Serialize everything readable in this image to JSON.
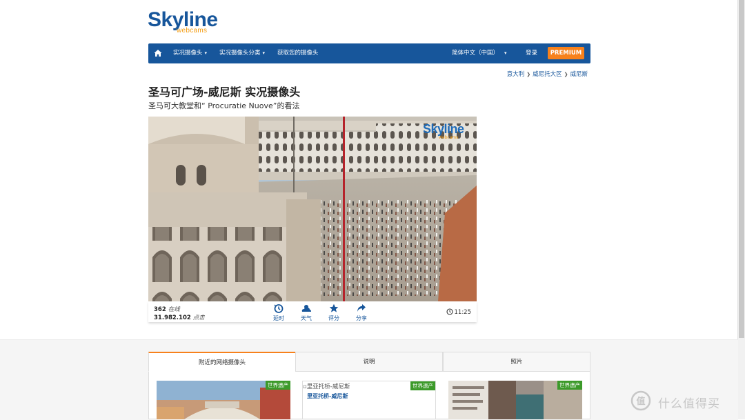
{
  "logo": {
    "main": "Skyline",
    "sub": "webcams"
  },
  "nav": {
    "items": [
      "实况摄像头",
      "实况摄像头分类",
      "获取您的摄像头"
    ],
    "language": "简体中文（中国）",
    "login": "登录",
    "premium": "PREMIUM"
  },
  "breadcrumb": [
    "意大利",
    "威尼托大区",
    "威尼斯"
  ],
  "page": {
    "title": "圣马可广场-威尼斯 实况摄像头",
    "subtitle": "圣马可大教堂和“ Procuratie Nuove”的看法"
  },
  "player": {
    "watermark": "Skyline",
    "watermark_sub": "webcams",
    "online_count": "362",
    "online_label": "在线",
    "clicks_count": "31.982.102",
    "clicks_label": "点击",
    "buttons": [
      "延时",
      "天气",
      "评分",
      "分享"
    ],
    "time": "11:25"
  },
  "tabs": [
    "附近的网络摄像头",
    "说明",
    "照片"
  ],
  "nearby": [
    {
      "badge": "世界遗产"
    },
    {
      "badge": "世界遗产",
      "alt": "里亚托桥-威尼斯",
      "title": "里亚托桥-威尼斯"
    },
    {
      "badge": "世界遗产"
    }
  ],
  "footer_mark": "什么值得买",
  "icons": {
    "home": "home-icon",
    "timelapse": "timelapse-icon",
    "weather": "weather-icon",
    "rating": "star-icon",
    "share": "share-icon",
    "clock": "clock-icon"
  },
  "colors": {
    "nav": "#17569b",
    "premium": "#f7811c",
    "badge": "#3c9a2a"
  }
}
